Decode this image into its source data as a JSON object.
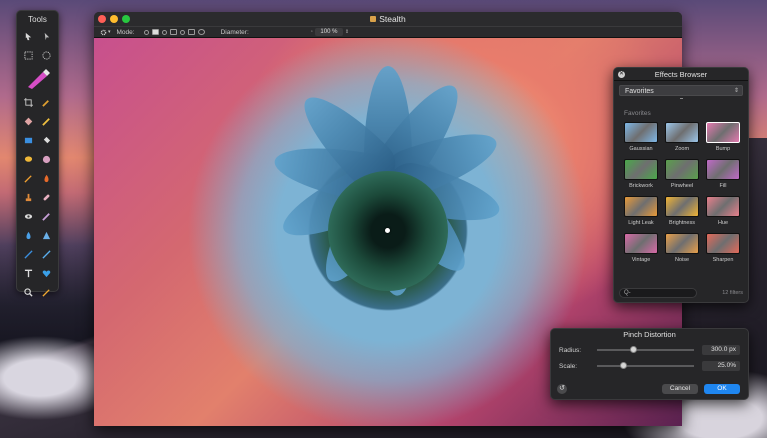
{
  "tools_panel": {
    "title": "Tools"
  },
  "window": {
    "title": "Stealth",
    "toolbar": {
      "mode_label": "Mode:",
      "diameter_label": "Diameter:",
      "zoom_value": "100 %"
    }
  },
  "effects_browser": {
    "title": "Effects Browser",
    "selected_category": "Favorites",
    "section_title": "Favorites",
    "effects": [
      {
        "label": "Gaussian",
        "color": "#7fb8e8"
      },
      {
        "label": "Zoom",
        "color": "#9cc6ea"
      },
      {
        "label": "Bump",
        "color": "#e47ab0"
      },
      {
        "label": "Brickwork",
        "color": "#4aa84a"
      },
      {
        "label": "Pinwheel",
        "color": "#5aa04c"
      },
      {
        "label": "Fill",
        "color": "#c06ac8"
      },
      {
        "label": "Light Leak",
        "color": "#e89a3a"
      },
      {
        "label": "Brightness",
        "color": "#f0b436"
      },
      {
        "label": "Hue",
        "color": "#e8808c"
      },
      {
        "label": "Vintage",
        "color": "#d86aa8"
      },
      {
        "label": "Noise",
        "color": "#e8a04a"
      },
      {
        "label": "Sharpen",
        "color": "#e46a5a"
      }
    ],
    "search_placeholder": "Q-",
    "filter_count": "12 filters"
  },
  "pinch_distortion": {
    "title": "Pinch Distortion",
    "radius_label": "Radius:",
    "radius_value": "300.0 px",
    "radius_fraction": 0.38,
    "scale_label": "Scale:",
    "scale_value": "25.0%",
    "scale_fraction": 0.28,
    "cancel_label": "Cancel",
    "ok_label": "OK"
  },
  "colors": {
    "accent": "#1f86f0"
  }
}
